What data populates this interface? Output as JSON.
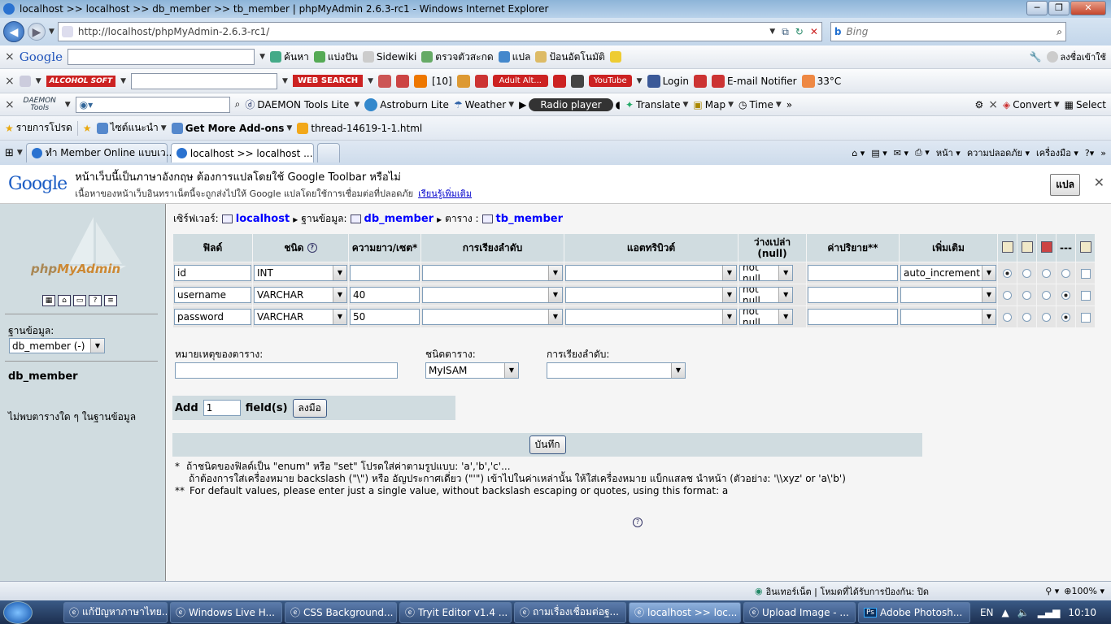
{
  "window": {
    "title": "localhost >> localhost >> db_member >> tb_member | phpMyAdmin 2.6.3-rc1 - Windows Internet Explorer",
    "min": "─",
    "max": "❐",
    "close": "✕"
  },
  "nav": {
    "address": "http://localhost/phpMyAdmin-2.6.3-rc1/",
    "search_placeholder": "Bing"
  },
  "google_toolbar": {
    "brand": "Google",
    "items": [
      "ค้นหา",
      "แบ่งปัน",
      "Sidewiki",
      "ตรวจตัวสะกด",
      "แปล",
      "ป้อนอัตโนมัติ"
    ],
    "signin": "ลงชื่อเข้าใช้"
  },
  "toolbar3": {
    "alcohol": "ALCOHOL SOFT",
    "websearch": "WEB SEARCH",
    "count": "[10]",
    "adult": "Adult Alt...",
    "youtube": "YouTube",
    "login": "Login",
    "email": "E-mail Notifier",
    "temp": "33°C"
  },
  "toolbar4": {
    "daemon": "DAEMON Tools",
    "daemon_lite": "DAEMON Tools Lite",
    "astroburn": "Astroburn Lite",
    "weather": "Weather",
    "radio": "Radio player",
    "translate": "Translate",
    "map": "Map",
    "time": "Time",
    "more": "»",
    "convert": "Convert",
    "select": "Select"
  },
  "favorites": {
    "label": "รายการโปรด",
    "items": [
      "ไซต์แนะนำ",
      "Get More Add-ons",
      "thread-14619-1-1.html"
    ]
  },
  "tabs": [
    {
      "label": "ทำ Member Online แบบเว..."
    },
    {
      "label": "localhost >> localhost ..."
    }
  ],
  "cmdbar": {
    "page": "หน้า",
    "safety": "ความปลอดภัย",
    "tools": "เครื่องมือ"
  },
  "translate_bar": {
    "logo": "Google",
    "msg": "หน้าเว็บนี้เป็นภาษาอังกฤษ ต้องการแปลโดยใช้ Google Toolbar หรือไม่",
    "sub": "เนื้อหาของหน้าเว็บอินทราเน็ตนี้จะถูกส่งไปให้ Google แปลโดยใช้การเชื่อมต่อที่ปลอดภัย",
    "link": "เรียนรู้เพิ่มเติม",
    "button": "แปล"
  },
  "left": {
    "logo_a": "php",
    "logo_b": "MyAdmin",
    "db_label": "ฐานข้อมูล:",
    "db_value": "db_member (-)",
    "db_name": "db_member",
    "no_tables": "ไม่พบตารางใด ๆ ในฐานข้อมูล"
  },
  "crumb": {
    "server_label": "เซิร์ฟเวอร์:",
    "server": "localhost",
    "db_label": "ฐานข้อมูล:",
    "db": "db_member",
    "table_label": "ตาราง :",
    "table": "tb_member"
  },
  "table": {
    "headers": [
      "ฟิลด์",
      "ชนิด",
      "ความยาว/เซต*",
      "การเรียงลำดับ",
      "แอตทริบิวต์",
      "ว่างเปล่า (null)",
      "ค่าปริยาย**",
      "เพิ่มเติม"
    ],
    "rows": [
      {
        "field": "id",
        "type": "INT",
        "length": "",
        "collation": "",
        "attributes": "",
        "null": "not null",
        "default": "",
        "extra": "auto_increment",
        "radio": 0,
        "checked": false
      },
      {
        "field": "username",
        "type": "VARCHAR",
        "length": "40",
        "collation": "",
        "attributes": "",
        "null": "not null",
        "default": "",
        "extra": "",
        "radio": 3,
        "checked": false
      },
      {
        "field": "password",
        "type": "VARCHAR",
        "length": "50",
        "collation": "",
        "attributes": "",
        "null": "not null",
        "default": "",
        "extra": "",
        "radio": 3,
        "checked": false
      }
    ],
    "dash": "---"
  },
  "options": {
    "comment_label": "หมายเหตุของตาราง:",
    "comment_value": "",
    "type_label": "ชนิดตาราง:",
    "type_value": "MyISAM",
    "collation_label": "การเรียงลำดับ:",
    "collation_value": ""
  },
  "add": {
    "label": "Add",
    "value": "1",
    "suffix": "field(s)",
    "button": "ลงมือ"
  },
  "save": {
    "button": "บันทึก"
  },
  "notes": {
    "n1_mark": "*",
    "n1_a": "ถ้าชนิดของฟิลด์เป็น \"enum\" หรือ \"set\" โปรดใส่ค่าตามรูปแบบ: 'a','b','c'...",
    "n1_b": "ถ้าต้องการใส่เครื่องหมาย backslash (\"\\\") หรือ อัญประกาศเดี่ยว (\"'\") เข้าไปในค่าเหล่านั้น ให้ใส่เครื่องหมาย แบ็กแสลช นำหน้า (ตัวอย่าง: '\\\\xyz' or 'a\\'b')",
    "n2_mark": "**",
    "n2": "For default values, please enter just a single value, without backslash escaping or quotes, using this format: a"
  },
  "status": {
    "zone": "อินเทอร์เน็ต | โหมดที่ได้รับการป้องกัน: ปิด",
    "zoom": "100%"
  },
  "taskbar": {
    "items": [
      "แก้ปัญหาภาษาไทย...",
      "Windows Live H...",
      "CSS Background...",
      "Tryit Editor v1.4 ...",
      "ถามเรื่องเชื่อมต่อฐ...",
      "localhost >> loc...",
      "Upload Image - ...",
      "Adobe Photosh..."
    ],
    "lang": "EN",
    "clock": "10:10"
  }
}
